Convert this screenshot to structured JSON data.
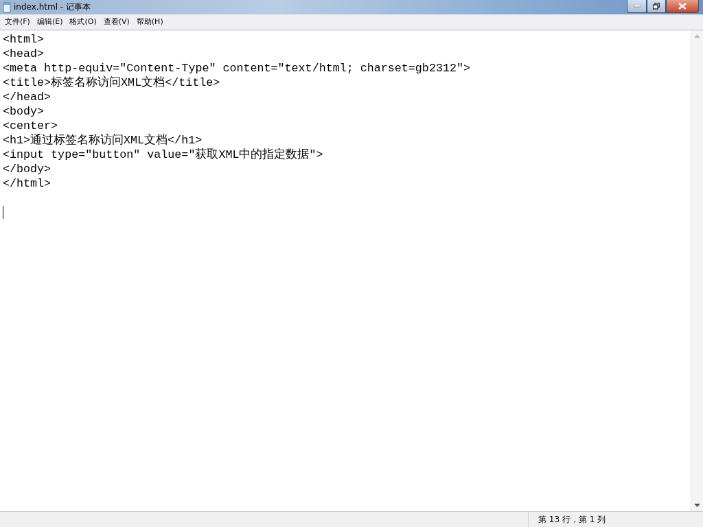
{
  "window": {
    "title": "index.html - 记事本"
  },
  "menu": [
    "文件(F)",
    "编辑(E)",
    "格式(O)",
    "查看(V)",
    "帮助(H)"
  ],
  "editor": {
    "lines": [
      "<html>",
      "<head>",
      "<meta http-equiv=\"Content-Type\" content=\"text/html; charset=gb2312\">",
      "<title>标签名称访问XML文档</title>",
      "</head>",
      "<body>",
      "<center>",
      "<h1>通过标签名称访问XML文档</h1>",
      "<input type=\"button\" value=\"获取XML中的指定数据\">",
      "</body>",
      "</html>"
    ]
  },
  "status_bar": {
    "position": "第 13 行，第 1 列"
  }
}
